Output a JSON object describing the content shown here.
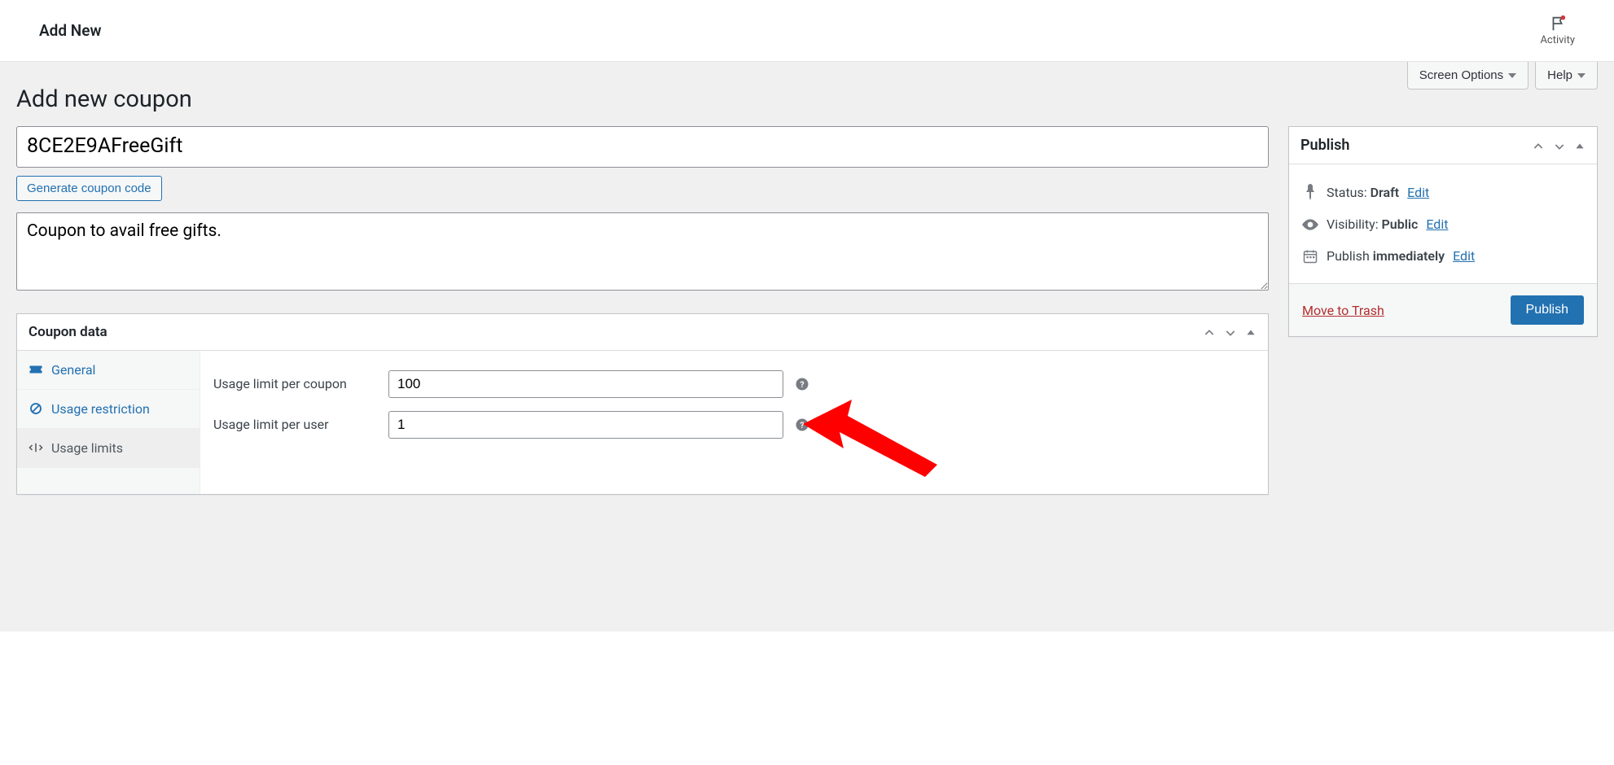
{
  "topbar": {
    "title": "Add New",
    "activity_label": "Activity"
  },
  "top_buttons": {
    "screen_options": "Screen Options",
    "help": "Help"
  },
  "heading": "Add new coupon",
  "coupon": {
    "code": "8CE2E9AFreeGift",
    "generate_label": "Generate coupon code",
    "description": "Coupon to avail free gifts."
  },
  "coupon_data": {
    "title": "Coupon data",
    "tabs": {
      "general": "General",
      "usage_restriction": "Usage restriction",
      "usage_limits": "Usage limits"
    },
    "fields": {
      "limit_per_coupon_label": "Usage limit per coupon",
      "limit_per_coupon_value": "100",
      "limit_per_user_label": "Usage limit per user",
      "limit_per_user_value": "1"
    }
  },
  "publish": {
    "title": "Publish",
    "status_label": "Status:",
    "status_value": "Draft",
    "visibility_label": "Visibility:",
    "visibility_value": "Public",
    "publish_label": "Publish",
    "publish_value": "immediately",
    "edit": "Edit",
    "trash": "Move to Trash",
    "publish_button": "Publish"
  }
}
